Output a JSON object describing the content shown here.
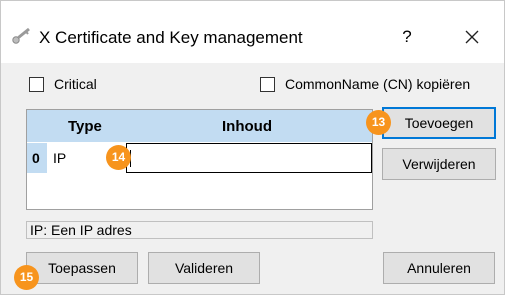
{
  "window": {
    "title": "X Certificate and Key management",
    "help_label": "?",
    "app_icon": "certificate-key-icon",
    "close_icon": "close-icon"
  },
  "options": {
    "critical_label": "Critical",
    "critical_checked": false,
    "copy_cn_label": "CommonName (CN) kopiëren",
    "copy_cn_checked": false
  },
  "table": {
    "columns": [
      "Type",
      "Inhoud"
    ],
    "rows": [
      {
        "index": "0",
        "type": "IP",
        "value": ""
      }
    ]
  },
  "buttons": {
    "add": "Toevoegen",
    "remove": "Verwijderen",
    "apply": "Toepassen",
    "validate": "Valideren",
    "cancel": "Annuleren"
  },
  "status_text": "IP: Een IP adres",
  "annotations": {
    "badge_13": "13",
    "badge_14": "14",
    "badge_15": "15"
  },
  "colors": {
    "header_bg": "#c2dcf2",
    "default_button_border": "#0078d7",
    "badge": "#f7941d"
  }
}
